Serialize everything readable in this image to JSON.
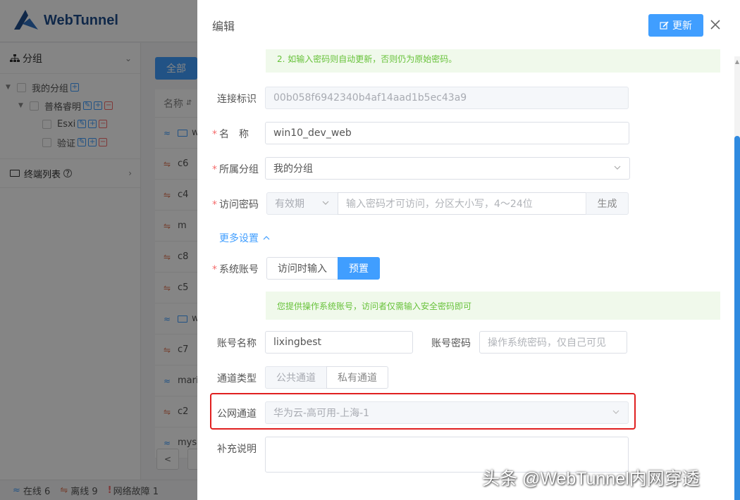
{
  "app": {
    "logo_text": "WebTunnel",
    "groups_title": "分组",
    "tree": [
      {
        "label": "我的分组",
        "level": 0
      },
      {
        "label": "普格睿明",
        "level": 1
      },
      {
        "label": "Esxi",
        "level": 2
      },
      {
        "label": "验证",
        "level": 2
      }
    ],
    "terminal_list": "终端列表",
    "all_button": "全部",
    "table_header_name": "名称",
    "rows": [
      {
        "status": "online",
        "name": "w"
      },
      {
        "status": "offline",
        "name": "c6"
      },
      {
        "status": "offline",
        "name": "c4"
      },
      {
        "status": "offline",
        "name": "m"
      },
      {
        "status": "offline",
        "name": "c8"
      },
      {
        "status": "offline",
        "name": "c5"
      },
      {
        "status": "online",
        "name": "w"
      },
      {
        "status": "offline",
        "name": "c7"
      },
      {
        "status": "online",
        "name": "mari"
      },
      {
        "status": "offline",
        "name": "c2"
      },
      {
        "status": "online",
        "name": "mys"
      }
    ],
    "status_bar": {
      "online": "在线 6",
      "offline": "离线 9",
      "fault": "网络故障 1"
    }
  },
  "drawer": {
    "title": "编辑",
    "update_button": "更新",
    "tip_top": "2. 如输入密码则自动更新，否则仍为原始密码。",
    "conn_id_label": "连接标识",
    "conn_id_value": "00b058f6942340b4af14aad1b5ec43a9",
    "name_label": "名　称",
    "name_value": "win10_dev_web",
    "group_label": "所属分组",
    "group_value": "我的分组",
    "password_label": "访问密码",
    "validity_value": "有效期",
    "password_placeholder": "输入密码才可访问，分区大小写，4～24位",
    "generate_button": "生成",
    "more_settings": "更多设置",
    "sys_account_label": "系统账号",
    "sys_account_options": [
      "访问时输入",
      "预置"
    ],
    "sys_account_tip": "您提供操作系统账号，访问者仅需输入安全密码即可",
    "account_name_label": "账号名称",
    "account_name_value": "lixingbest",
    "account_pwd_label": "账号密码",
    "account_pwd_placeholder": "操作系统密码，仅自己可见",
    "channel_type_label": "通道类型",
    "channel_type_options": [
      "公共通道",
      "私有通道"
    ],
    "public_channel_label": "公网通道",
    "public_channel_value": "华为云-高可用-上海-1",
    "remark_label": "补充说明"
  },
  "watermark": "头条 @WebTunnel内网穿透",
  "colors": {
    "primary": "#409eff",
    "success_bg": "#f0f9eb",
    "success_text": "#67c23a",
    "highlight": "#e02020",
    "offline": "#e07b5b"
  }
}
